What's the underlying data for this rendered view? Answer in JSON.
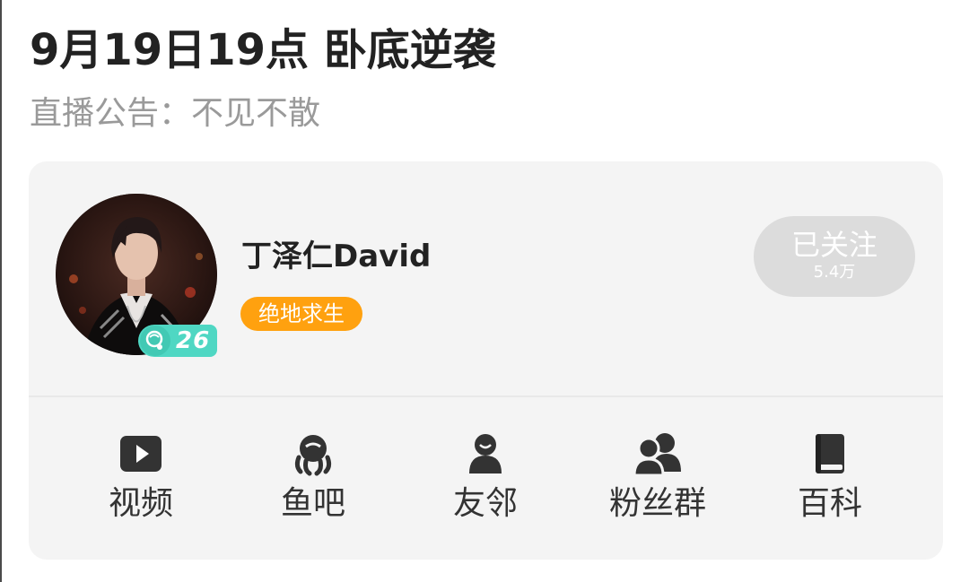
{
  "room": {
    "title": "9月19日19点 卧底逆袭",
    "notice": "直播公告：不见不散"
  },
  "streamer": {
    "name": "丁泽仁David",
    "level": "26",
    "category": "绝地求生",
    "avatar_icon": "streamer-avatar-photo"
  },
  "follow": {
    "label": "已关注",
    "count": "5.4万"
  },
  "nav": [
    {
      "label": "视频",
      "icon": "video-play-icon"
    },
    {
      "label": "鱼吧",
      "icon": "fish-bar-icon"
    },
    {
      "label": "友邻",
      "icon": "person-icon"
    },
    {
      "label": "粉丝群",
      "icon": "group-icon"
    },
    {
      "label": "百科",
      "icon": "book-icon"
    }
  ],
  "colors": {
    "category_tag": "#ffa10f",
    "level_badge": "#4fd7c3",
    "follow_button": "#dcdcdc",
    "card_background": "#f4f4f4",
    "icon": "#333333"
  }
}
